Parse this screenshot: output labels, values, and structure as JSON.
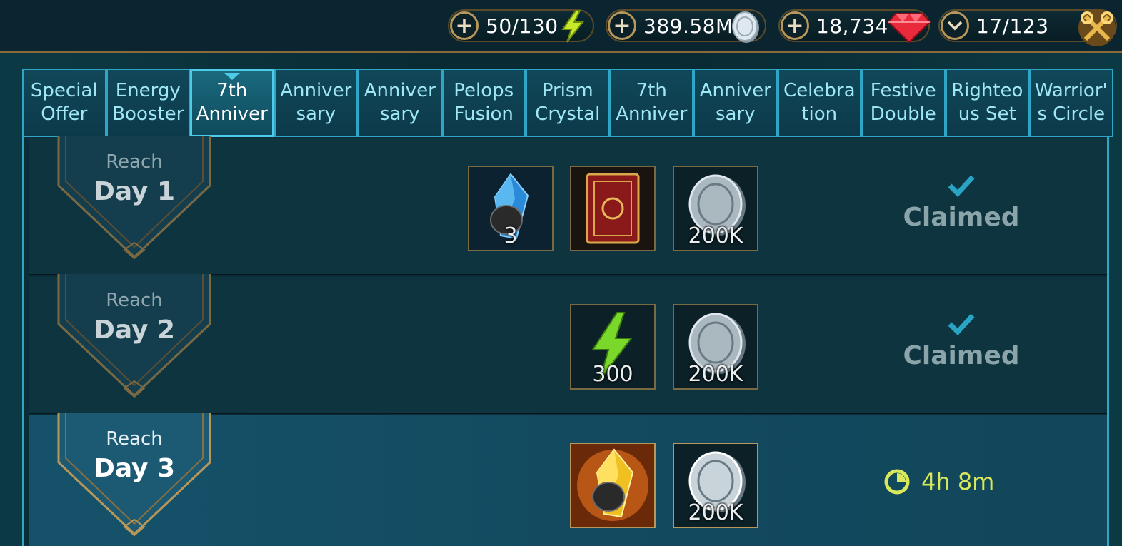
{
  "resources": {
    "energy": {
      "value": "50/130",
      "icon": "lightning-icon"
    },
    "silver": {
      "value": "389.58M",
      "icon": "silver-coin-icon"
    },
    "gems": {
      "value": "18,734",
      "icon": "ruby-gem-icon"
    },
    "keys": {
      "value": "17/123",
      "icon": "keys-icon"
    }
  },
  "tabs": [
    {
      "label": "Special\nOffer"
    },
    {
      "label": "Energy\nBooster"
    },
    {
      "label": "7th\nAnniver",
      "active": true
    },
    {
      "label": "Anniver\nsary"
    },
    {
      "label": "Anniver\nsary"
    },
    {
      "label": "Pelops\nFusion"
    },
    {
      "label": "Prism\nCrystal"
    },
    {
      "label": "7th\nAnniver"
    },
    {
      "label": "Anniver\nsary"
    },
    {
      "label": "Celebra\ntion"
    },
    {
      "label": "Festive\nDouble"
    },
    {
      "label": "Righteo\nus Set"
    },
    {
      "label": "Warrior'\ns Circle"
    }
  ],
  "rows": [
    {
      "reach": "Reach",
      "day": "Day 1",
      "rewards": [
        {
          "icon": "ancient-shard-icon",
          "qty": "3"
        },
        {
          "icon": "tome-icon",
          "qty": ""
        },
        {
          "icon": "silver-coin-icon",
          "qty": "200K"
        }
      ],
      "status": "Claimed"
    },
    {
      "reach": "Reach",
      "day": "Day 2",
      "rewards": [
        {
          "icon": "energy-icon",
          "qty": "300"
        },
        {
          "icon": "silver-coin-icon",
          "qty": "200K"
        }
      ],
      "status": "Claimed"
    },
    {
      "reach": "Reach",
      "day": "Day 3",
      "rewards": [
        {
          "icon": "sacred-shard-icon",
          "qty": ""
        },
        {
          "icon": "silver-coin-icon",
          "qty": "200K"
        }
      ],
      "timer": "4h 8m"
    }
  ]
}
